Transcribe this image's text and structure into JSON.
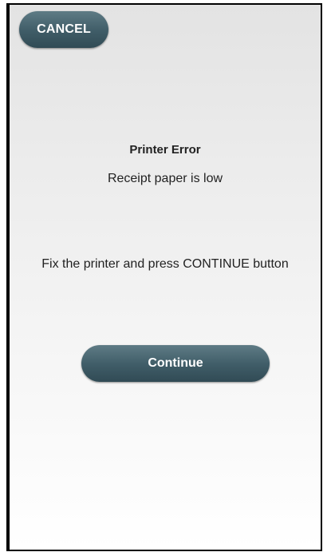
{
  "header": {
    "cancel_label": "CANCEL"
  },
  "message": {
    "title": "Printer Error",
    "subtitle": "Receipt paper is low",
    "instruction": "Fix the printer and press CONTINUE button"
  },
  "actions": {
    "continue_label": "Continue"
  },
  "colors": {
    "button_accent": "#3f5c67",
    "text": "#222222"
  }
}
